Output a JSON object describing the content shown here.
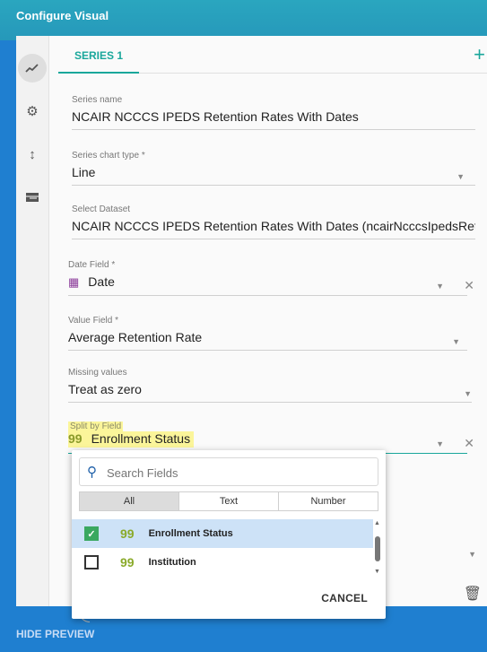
{
  "header": {
    "title": "Configure Visual"
  },
  "rail": {
    "icons": [
      "trend-icon",
      "gear-icon",
      "resize-arrows-icon",
      "table-icon"
    ]
  },
  "tabs": {
    "series1": "SERIES 1",
    "add": "+"
  },
  "fields": {
    "series_name": {
      "label": "Series name",
      "value": "NCAIR NCCCS IPEDS Retention Rates With Dates"
    },
    "chart_type": {
      "label": "Series chart type *",
      "value": "Line"
    },
    "dataset": {
      "label": "Select Dataset",
      "value": "NCAIR NCCCS IPEDS Retention Rates With Dates (ncairNcccsIpedsRete"
    },
    "date_field": {
      "label": "Date Field *",
      "value": "Date"
    },
    "value_field": {
      "label": "Value Field *",
      "value": "Average Retention Rate"
    },
    "missing": {
      "label": "Missing values",
      "value": "Treat as zero"
    },
    "split": {
      "label": "Split by Field",
      "value": "Enrollment Status"
    }
  },
  "popup": {
    "search_placeholder": "Search Fields",
    "filter_tabs": [
      "All",
      "Text",
      "Number"
    ],
    "options": [
      {
        "label": "Enrollment Status",
        "checked": true
      },
      {
        "label": "Institution",
        "checked": false
      }
    ],
    "cancel": "CANCEL"
  },
  "footer": {
    "hide_preview": "HIDE PREVIEW"
  },
  "colors": {
    "teal": "#19a79b",
    "header": "#2aa6bf",
    "background": "#1f7fd0",
    "highlight": "#fbf59a",
    "selected_row": "#cde2f7"
  }
}
